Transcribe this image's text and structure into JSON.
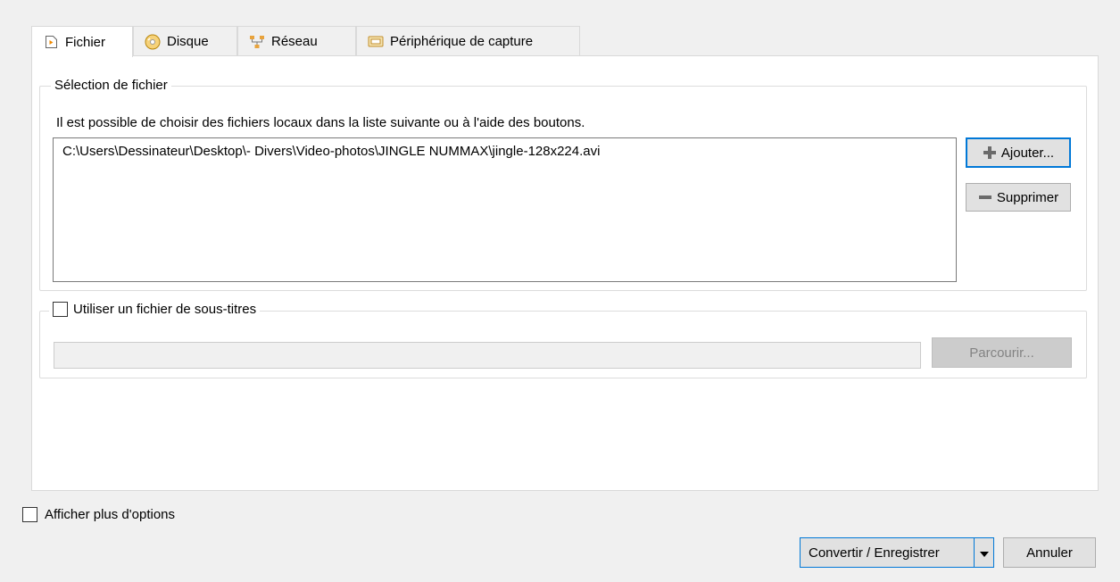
{
  "tabs": [
    {
      "label": "Fichier",
      "icon": "file-play-icon",
      "active": true
    },
    {
      "label": "Disque",
      "icon": "disc-icon",
      "active": false
    },
    {
      "label": "Réseau",
      "icon": "network-icon",
      "active": false
    },
    {
      "label": "Périphérique de capture",
      "icon": "capture-device-icon",
      "active": false
    }
  ],
  "file_selection": {
    "title": "Sélection de fichier",
    "hint": "Il est possible de choisir des fichiers locaux dans la liste suivante ou à l'aide des boutons.",
    "files": [
      "C:\\Users\\Dessinateur\\Desktop\\- Divers\\Video-photos\\JINGLE NUMMAX\\jingle-128x224.avi"
    ],
    "add_label": "Ajouter...",
    "remove_label": "Supprimer"
  },
  "subtitles": {
    "checkbox_label": "Utiliser un fichier de sous-titres",
    "checked": false,
    "path_value": "",
    "browse_label": "Parcourir..."
  },
  "footer": {
    "more_options_label": "Afficher plus d'options",
    "more_options_checked": false,
    "convert_label": "Convertir / Enregistrer",
    "cancel_label": "Annuler"
  },
  "colors": {
    "accent": "#0078d7",
    "window_bg": "#f0f0f0",
    "panel_bg": "#ffffff"
  }
}
